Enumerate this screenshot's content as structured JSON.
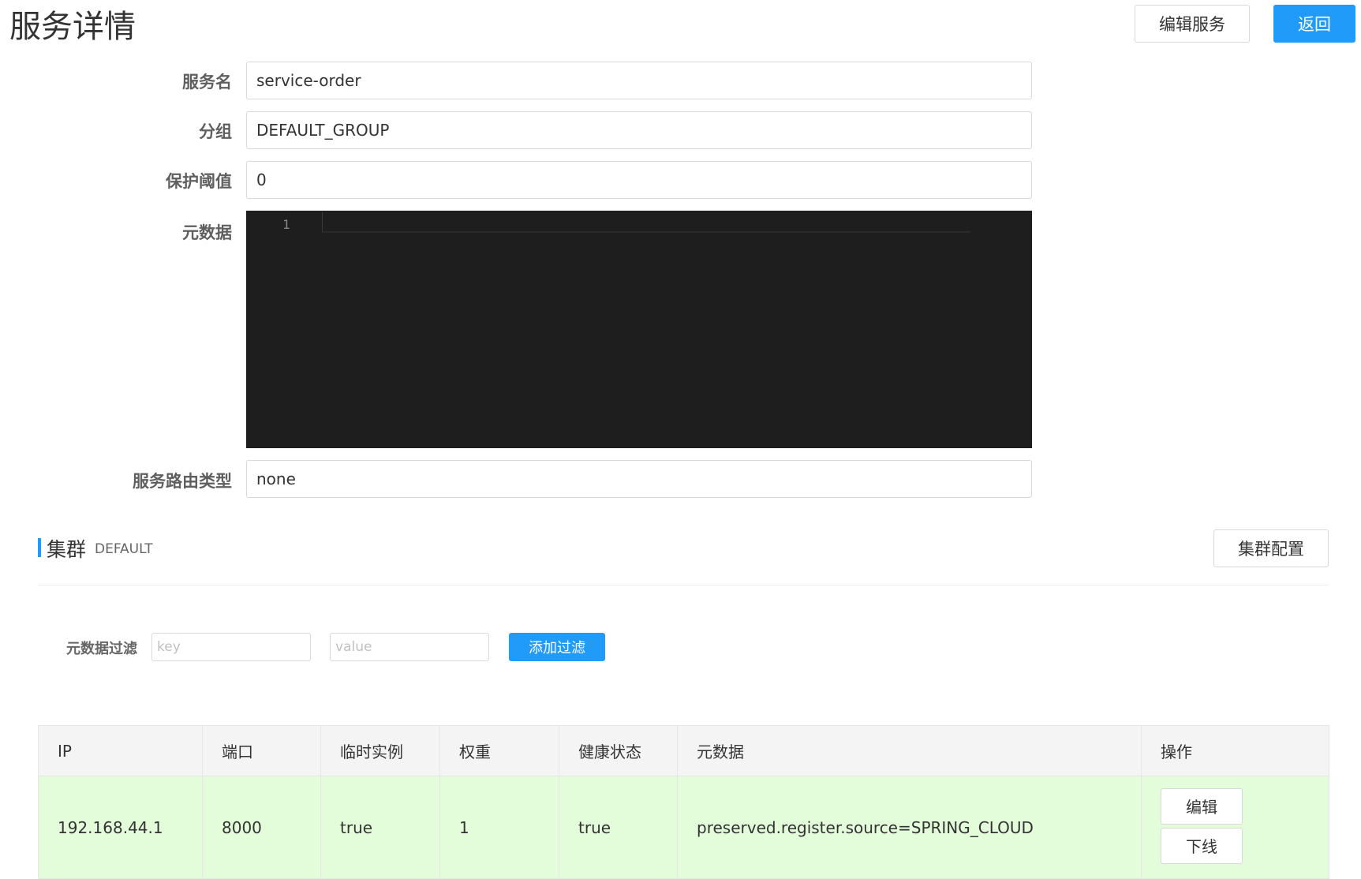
{
  "header": {
    "title": "服务详情",
    "edit_service_label": "编辑服务",
    "back_label": "返回"
  },
  "form": {
    "service_name": {
      "label": "服务名",
      "value": "service-order"
    },
    "group": {
      "label": "分组",
      "value": "DEFAULT_GROUP"
    },
    "protect_threshold": {
      "label": "保护阈值",
      "value": "0"
    },
    "metadata": {
      "label": "元数据",
      "line_number": "1",
      "value": ""
    },
    "selector_type": {
      "label": "服务路由类型",
      "value": "none"
    }
  },
  "cluster": {
    "title": "集群",
    "name": "DEFAULT",
    "config_label": "集群配置"
  },
  "filter": {
    "label": "元数据过滤",
    "key_placeholder": "key",
    "value_placeholder": "value",
    "add_label": "添加过滤"
  },
  "table": {
    "columns": [
      "IP",
      "端口",
      "临时实例",
      "权重",
      "健康状态",
      "元数据",
      "操作"
    ],
    "rows": [
      {
        "ip": "192.168.44.1",
        "port": "8000",
        "ephemeral": "true",
        "weight": "1",
        "healthy": "true",
        "metadata": "preserved.register.source=SPRING_CLOUD",
        "edit_label": "编辑",
        "offline_label": "下线"
      }
    ]
  },
  "colors": {
    "primary": "#209bfa",
    "row_healthy_bg": "#e3fcd9",
    "editor_bg": "#1e1e1e"
  }
}
